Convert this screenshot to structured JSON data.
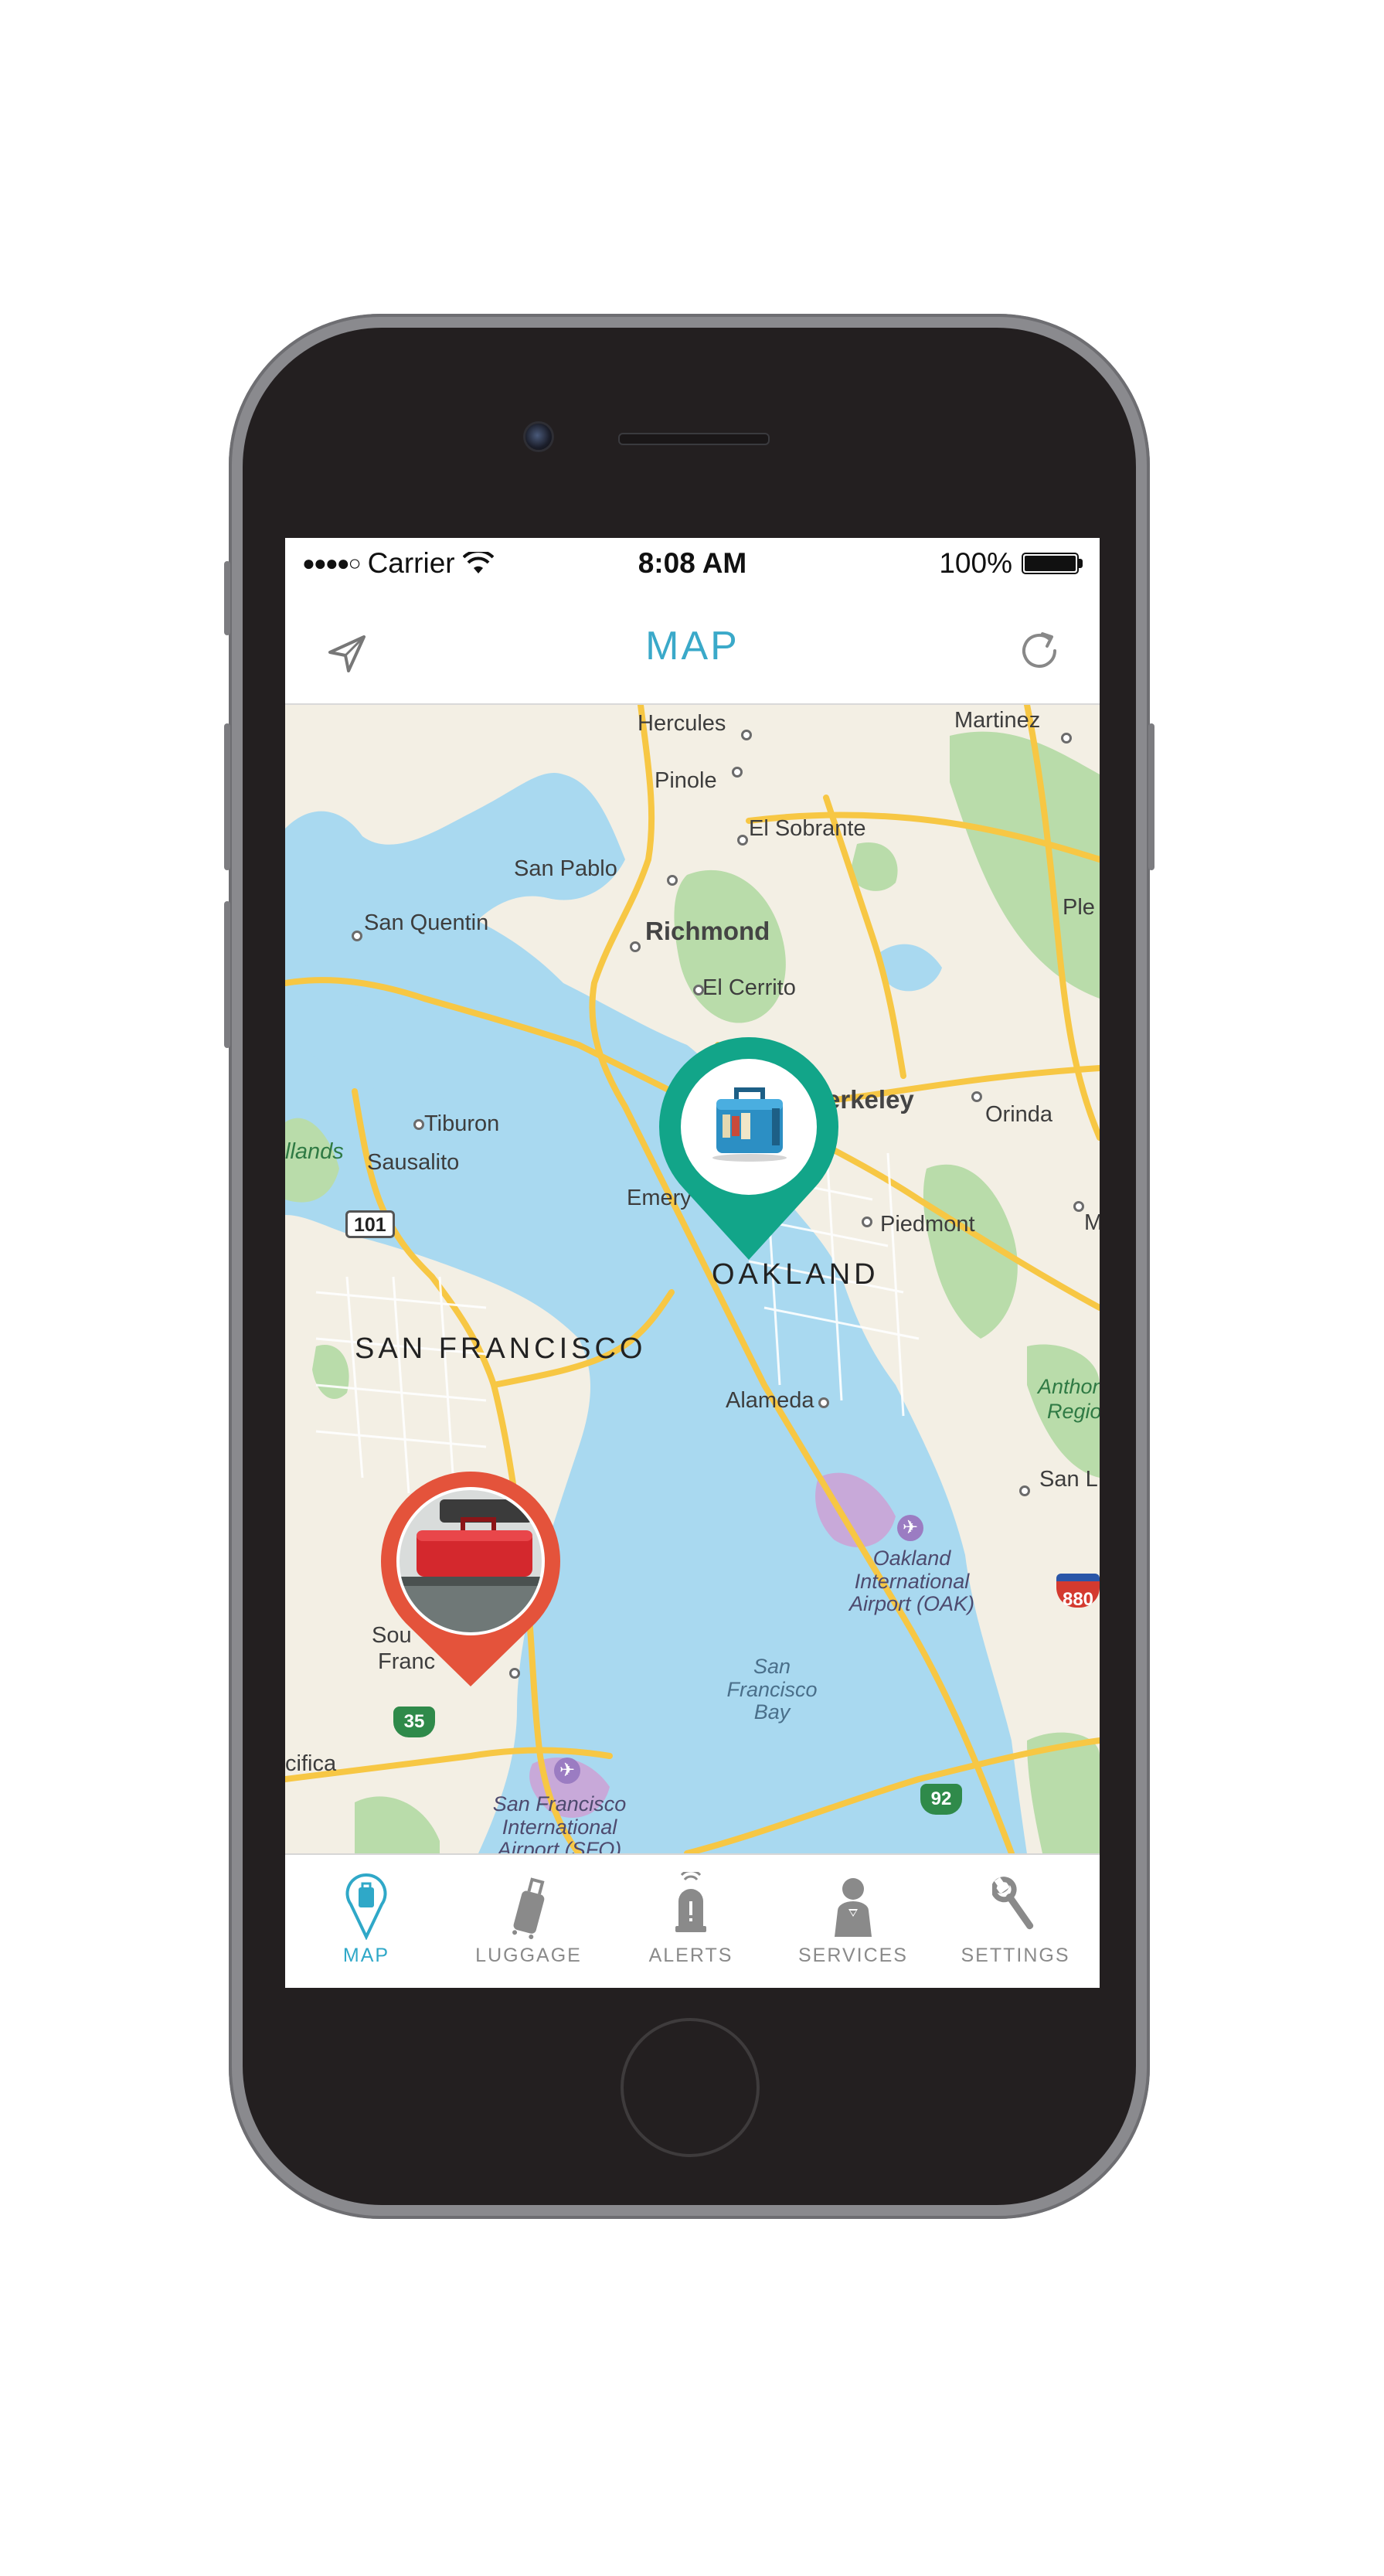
{
  "status_bar": {
    "signal": "●●●●○",
    "carrier": "Carrier",
    "time": "8:08 AM",
    "battery_percent": "100%"
  },
  "nav_bar": {
    "title": "MAP",
    "left_icon": "location-arrow-icon",
    "right_icon": "refresh-icon"
  },
  "map": {
    "labels": {
      "hercules": "Hercules",
      "martinez": "Martinez",
      "pinole": "Pinole",
      "el_sobrante": "El Sobrante",
      "san_pablo": "San Pablo",
      "pleasant": "Ple",
      "san_quentin": "San Quentin",
      "richmond": "Richmond",
      "el_cerrito": "El Cerrito",
      "berkeley": "erkeley",
      "orinda": "Orinda",
      "tiburon": "Tiburon",
      "islands": "llands",
      "sausalito": "Sausalito",
      "emeryville": "Emery",
      "piedmont": "Piedmont",
      "m_edge": "M",
      "oakland": "OAKLAND",
      "san_francisco": "SAN FRANCISCO",
      "alameda": "Alameda",
      "antioch": "Anthon",
      "region": "Regio",
      "san_leandro": "San L",
      "oakland_airport": "Oakland International Airport (OAK)",
      "south_sf_1": "Sou",
      "south_sf_2": "Franc",
      "sf_bay": "San Francisco Bay",
      "pacifica": "cifica",
      "sfo": "San Francisco International Airport (SFO)"
    },
    "shields": {
      "us101": "101",
      "i880": "880",
      "ca35": "35",
      "ca92": "92"
    },
    "pins": [
      {
        "name": "teal-luggage-pin",
        "color": "#12a589",
        "icon": "blue-suitcase-photo"
      },
      {
        "name": "red-luggage-pin",
        "color": "#e4533b",
        "icon": "red-suitcase-carousel-photo"
      }
    ],
    "colors": {
      "water": "#a9d9f0",
      "land": "#f3efe4",
      "park": "#b9dcaa",
      "road": "#f7c744",
      "airport": "#c8a9d9"
    }
  },
  "tab_bar": {
    "items": [
      {
        "label": "MAP",
        "icon": "map-pin-luggage-icon",
        "active": true
      },
      {
        "label": "LUGGAGE",
        "icon": "suitcase-icon",
        "active": false
      },
      {
        "label": "ALERTS",
        "icon": "bell-alert-icon",
        "active": false
      },
      {
        "label": "SERVICES",
        "icon": "concierge-person-icon",
        "active": false
      },
      {
        "label": "SETTINGS",
        "icon": "wrench-icon",
        "active": false
      }
    ],
    "accent_color": "#2fa8c8"
  }
}
